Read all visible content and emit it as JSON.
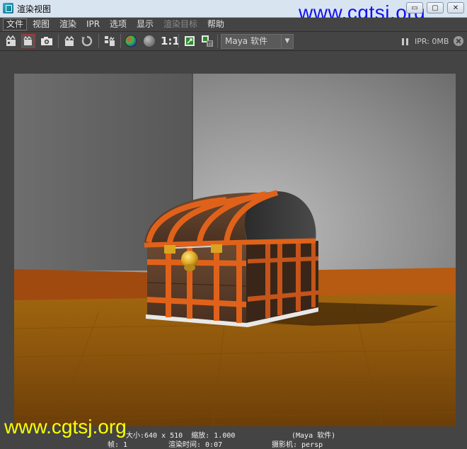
{
  "window": {
    "title": "渲染视图",
    "watermark_top": "www.cgtsj.org",
    "controls": [
      "▭",
      "▢",
      "✕"
    ]
  },
  "menu": {
    "items": [
      {
        "label": "文件",
        "active": true,
        "disabled": false
      },
      {
        "label": "视图",
        "active": false,
        "disabled": false
      },
      {
        "label": "渲染",
        "active": false,
        "disabled": false
      },
      {
        "label": "IPR",
        "active": false,
        "disabled": false
      },
      {
        "label": "选项",
        "active": false,
        "disabled": false
      },
      {
        "label": "显示",
        "active": false,
        "disabled": false
      },
      {
        "label": "渲染目标",
        "active": false,
        "disabled": true
      },
      {
        "label": "帮助",
        "active": false,
        "disabled": false
      }
    ]
  },
  "toolbar": {
    "ratio_label": "1:1",
    "renderer_value": "Maya 软件",
    "ipr_status": "IPR: 0MB"
  },
  "hud": {
    "size_line": "大小:640 x 510  缩放: 1.000",
    "renderer_line": "(Maya 软件)",
    "frame_line": "帧: 1",
    "time_line": "渲染时间: 0:07",
    "camera_line": "摄影机: persp"
  },
  "watermark_bottom": "www.cgtsj.org",
  "colors": {
    "accent_blue": "#1010f0",
    "watermark_yellow": "#ffff00",
    "panel_gray": "#444444",
    "chest_orange": "#e0621a"
  }
}
